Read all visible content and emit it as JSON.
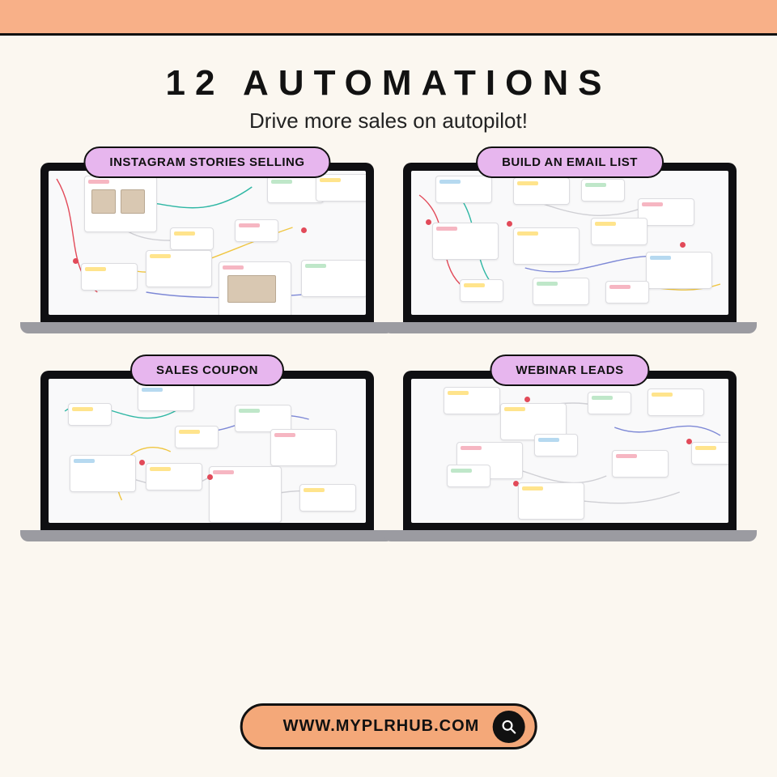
{
  "heading": {
    "title": "12 AUTOMATIONS",
    "subtitle": "Drive more sales on autopilot!"
  },
  "tiles": [
    {
      "label": "INSTAGRAM STORIES SELLING"
    },
    {
      "label": "BUILD AN EMAIL LIST"
    },
    {
      "label": "SALES COUPON"
    },
    {
      "label": "WEBINAR LEADS"
    }
  ],
  "url_bar": {
    "text": "WWW.MYPLRHUB.COM",
    "icon": "search-icon"
  },
  "colors": {
    "band": "#f8b088",
    "pill": "#e7b6ee",
    "url": "#f4a879",
    "bg": "#fbf7f0"
  }
}
